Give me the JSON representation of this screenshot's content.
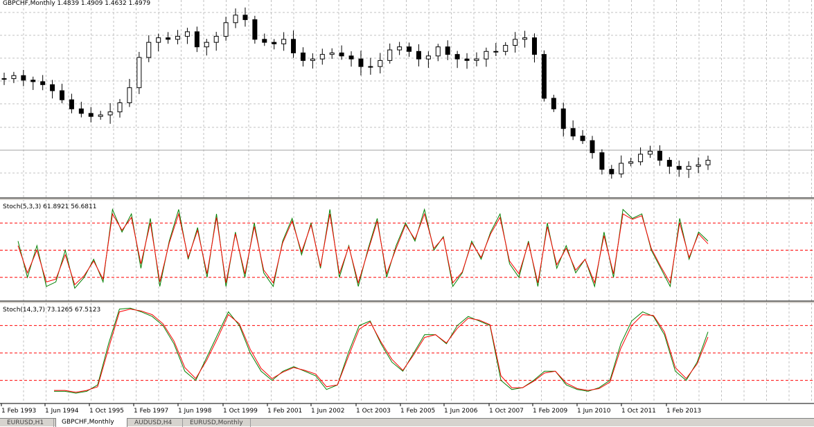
{
  "panes": [
    {
      "id": "price",
      "label": "GBPCHF,Monthly  1.4839 1.4909 1.4632 1.4979"
    },
    {
      "id": "stoch1",
      "label": "Stoch(5,3,3) 61.8921 56.6811"
    },
    {
      "id": "stoch2",
      "label": "Stoch(14,3,7) 73.1265 67.5123"
    }
  ],
  "x_axis_labels": [
    "1 Feb 1993",
    "1 Jun 1994",
    "1 Oct 1995",
    "1 Feb 1997",
    "1 Jun 1998",
    "1 Oct 1999",
    "1 Feb 2001",
    "1 Jun 2002",
    "1 Oct 2003",
    "1 Feb 2005",
    "1 Jun 2006",
    "1 Oct 2007",
    "1 Feb 2009",
    "1 Jun 2010",
    "1 Oct 2011",
    "1 Feb 2013"
  ],
  "tabs": [
    {
      "label": "EURUSD,H1",
      "active": false
    },
    {
      "label": "GBPCHF,Monthly",
      "active": true
    },
    {
      "label": "AUDUSD,H4",
      "active": false
    },
    {
      "label": "EURUSD,Monthly",
      "active": false
    }
  ],
  "colors": {
    "grid": "#c0c0c0",
    "candle": "#000000",
    "main_line": "#008000",
    "signal_line": "#ff0000",
    "level": "#ff0000",
    "separator": "#000000"
  },
  "chart_data": [
    {
      "type": "candlestick",
      "title": "GBPCHF,Monthly",
      "series": [
        {
          "name": "GBPCHF",
          "values": [
            2.18,
            2.2,
            2.17,
            2.16,
            2.14,
            2.1,
            2.04,
            1.98,
            1.95,
            1.93,
            1.94,
            1.96,
            2.02,
            2.12,
            2.32,
            2.42,
            2.45,
            2.44,
            2.46,
            2.49,
            2.39,
            2.42,
            2.46,
            2.55,
            2.6,
            2.57,
            2.44,
            2.42,
            2.41,
            2.44,
            2.35,
            2.3,
            2.31,
            2.34,
            2.35,
            2.33,
            2.31,
            2.26,
            2.26,
            2.3,
            2.37,
            2.39,
            2.36,
            2.31,
            2.33,
            2.39,
            2.34,
            2.31,
            2.3,
            2.31,
            2.36,
            2.36,
            2.4,
            2.44,
            2.45,
            2.34,
            2.05,
            1.98,
            1.85,
            1.8,
            1.77,
            1.69,
            1.58,
            1.55,
            1.62,
            1.63,
            1.68,
            1.7,
            1.64,
            1.6,
            1.58,
            1.6,
            1.61,
            1.64
          ]
        }
      ],
      "y_range": [
        1.4,
        2.7
      ]
    },
    {
      "type": "line",
      "title": "Stoch(5,3,3) 61.8921 56.6811",
      "ylim": [
        0,
        100
      ],
      "levels": [
        20,
        50,
        80
      ],
      "series": [
        {
          "name": "main",
          "values": [
            60,
            20,
            55,
            10,
            15,
            50,
            8,
            20,
            40,
            15,
            95,
            70,
            90,
            30,
            85,
            10,
            60,
            95,
            40,
            75,
            20,
            90,
            10,
            70,
            20,
            80,
            25,
            10,
            60,
            85,
            45,
            80,
            30,
            95,
            20,
            55,
            10,
            50,
            85,
            20,
            55,
            80,
            60,
            95,
            50,
            65,
            10,
            25,
            60,
            40,
            70,
            90,
            35,
            20,
            60,
            10,
            80,
            30,
            55,
            25,
            40,
            10,
            70,
            20,
            95,
            85,
            90,
            50,
            30,
            10,
            85,
            40,
            70,
            60
          ]
        },
        {
          "name": "signal",
          "values": [
            55,
            25,
            50,
            15,
            18,
            45,
            12,
            22,
            38,
            18,
            90,
            72,
            86,
            35,
            80,
            15,
            58,
            90,
            42,
            72,
            24,
            86,
            14,
            68,
            24,
            76,
            28,
            14,
            58,
            82,
            48,
            78,
            32,
            90,
            24,
            54,
            14,
            48,
            82,
            24,
            52,
            78,
            62,
            90,
            52,
            64,
            14,
            26,
            58,
            42,
            68,
            86,
            38,
            24,
            58,
            14,
            76,
            34,
            52,
            28,
            40,
            14,
            66,
            24,
            90,
            84,
            88,
            52,
            32,
            14,
            80,
            42,
            68,
            57
          ]
        }
      ]
    },
    {
      "type": "line",
      "title": "Stoch(14,3,7) 73.1265 67.5123",
      "ylim": [
        0,
        100
      ],
      "levels": [
        20,
        50,
        80
      ],
      "series": [
        {
          "name": "main",
          "values": [
            8,
            8,
            6,
            8,
            15,
            60,
            98,
            99,
            95,
            90,
            80,
            60,
            30,
            20,
            45,
            70,
            95,
            80,
            50,
            30,
            20,
            30,
            35,
            30,
            25,
            10,
            15,
            50,
            80,
            85,
            60,
            40,
            30,
            50,
            70,
            70,
            60,
            80,
            90,
            85,
            80,
            20,
            10,
            12,
            20,
            30,
            30,
            15,
            10,
            8,
            12,
            20,
            60,
            85,
            95,
            90,
            70,
            30,
            20,
            40,
            73
          ]
        },
        {
          "name": "signal",
          "values": [
            9,
            9,
            7,
            9,
            13,
            55,
            95,
            98,
            96,
            92,
            82,
            63,
            34,
            22,
            42,
            66,
            92,
            82,
            54,
            33,
            22,
            29,
            34,
            31,
            27,
            13,
            15,
            46,
            76,
            84,
            62,
            43,
            31,
            48,
            67,
            70,
            61,
            77,
            88,
            86,
            81,
            25,
            12,
            12,
            19,
            28,
            30,
            17,
            11,
            9,
            11,
            18,
            55,
            80,
            92,
            91,
            73,
            34,
            22,
            38,
            67.5
          ]
        }
      ]
    }
  ]
}
